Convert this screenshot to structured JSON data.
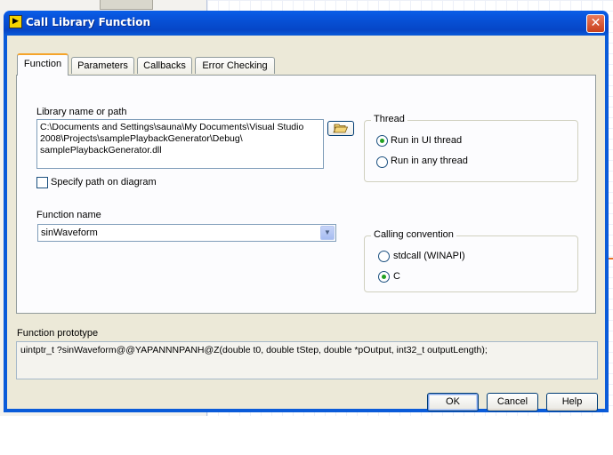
{
  "window": {
    "title": "Call Library Function",
    "app_icon": "labview-icon",
    "close_icon": "close-icon"
  },
  "tabs": [
    {
      "label": "Function",
      "active": true
    },
    {
      "label": "Parameters",
      "active": false
    },
    {
      "label": "Callbacks",
      "active": false
    },
    {
      "label": "Error Checking",
      "active": false
    }
  ],
  "function_tab": {
    "library_label": "Library name or path",
    "library_path": "C:\\Documents and Settings\\sauna\\My Documents\\Visual Studio\n2008\\Projects\\samplePlaybackGenerator\\Debug\\\nsamplePlaybackGenerator.dll",
    "browse_icon": "folder-open-icon",
    "specify_path_label": "Specify path on diagram",
    "specify_path_checked": false,
    "function_name_label": "Function name",
    "function_name_value": "sinWaveform",
    "thread": {
      "title": "Thread",
      "options": [
        "Run in UI thread",
        "Run in any thread"
      ],
      "selected": "Run in UI thread"
    },
    "calling_convention": {
      "title": "Calling convention",
      "options": [
        "stdcall (WINAPI)",
        "C"
      ],
      "selected": "C"
    }
  },
  "prototype": {
    "label": "Function prototype",
    "text": "uintptr_t ?sinWaveform@@YAPANNNPANH@Z(double t0, double tStep, double *pOutput, int32_t outputLength);"
  },
  "buttons": {
    "ok": "OK",
    "cancel": "Cancel",
    "help": "Help"
  },
  "colors": {
    "title_bar": "#0a5bd9",
    "dialog_face": "#ece9d8",
    "active_tab_accent": "#f5a42b",
    "radio_dot": "#21a121"
  }
}
